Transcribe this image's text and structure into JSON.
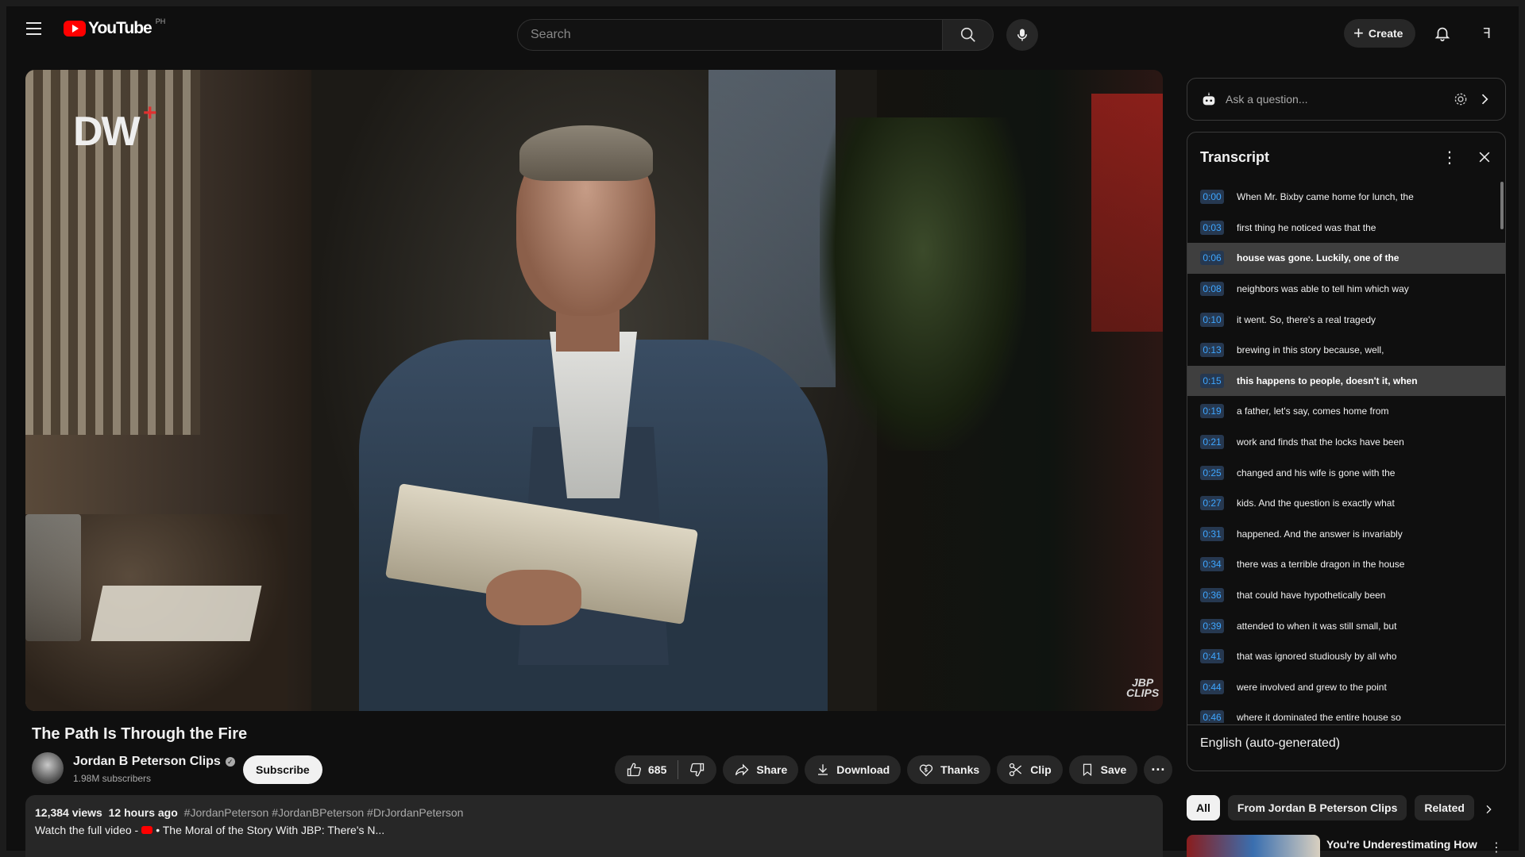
{
  "header": {
    "logo_text": "YouTube",
    "country_code": "PH",
    "search_placeholder": "Search",
    "create_label": "Create",
    "avatar_initial": "ꟻ"
  },
  "player": {
    "watermark_left": "DW",
    "watermark_plus": "+",
    "watermark_right_line1": "JBP",
    "watermark_right_line2": "CLIPS"
  },
  "video": {
    "title": "The Path Is Through the Fire",
    "channel_name": "Jordan B Peterson Clips",
    "subscribers": "1.98M subscribers",
    "subscribe_label": "Subscribe",
    "like_count": "685",
    "share_label": "Share",
    "download_label": "Download",
    "thanks_label": "Thanks",
    "clip_label": "Clip",
    "save_label": "Save"
  },
  "description": {
    "views": "12,384 views",
    "age": "12 hours ago",
    "tags": "#JordanPeterson #JordanBPeterson #DrJordanPeterson",
    "line2_prefix": "Watch the full video -",
    "line2_link": "• The Moral of the Story With JBP: There's N..."
  },
  "ask": {
    "placeholder": "Ask a question..."
  },
  "transcript": {
    "title": "Transcript",
    "language": "English (auto-generated)",
    "rows": [
      {
        "time": "0:00",
        "text": "When Mr. Bixby came home for lunch, the",
        "active": false
      },
      {
        "time": "0:03",
        "text": "first thing he noticed was that the",
        "active": false
      },
      {
        "time": "0:06",
        "text": "house was gone. Luckily, one of the",
        "active": true
      },
      {
        "time": "0:08",
        "text": "neighbors was able to tell him which way",
        "active": false
      },
      {
        "time": "0:10",
        "text": "it went. So, there's a real tragedy",
        "active": false
      },
      {
        "time": "0:13",
        "text": "brewing in this story because, well,",
        "active": false
      },
      {
        "time": "0:15",
        "text": "this happens to people, doesn't it, when",
        "active": true
      },
      {
        "time": "0:19",
        "text": "a father, let's say, comes home from",
        "active": false
      },
      {
        "time": "0:21",
        "text": "work and finds that the locks have been",
        "active": false
      },
      {
        "time": "0:25",
        "text": "changed and his wife is gone with the",
        "active": false
      },
      {
        "time": "0:27",
        "text": "kids. And the question is exactly what",
        "active": false
      },
      {
        "time": "0:31",
        "text": "happened. And the answer is invariably",
        "active": false
      },
      {
        "time": "0:34",
        "text": "there was a terrible dragon in the house",
        "active": false
      },
      {
        "time": "0:36",
        "text": "that could have hypothetically been",
        "active": false
      },
      {
        "time": "0:39",
        "text": "attended to when it was still small, but",
        "active": false
      },
      {
        "time": "0:41",
        "text": "that was ignored studiously by all who",
        "active": false
      },
      {
        "time": "0:44",
        "text": "were involved and grew to the point",
        "active": false
      },
      {
        "time": "0:46",
        "text": "where it dominated the entire house so",
        "active": false
      }
    ]
  },
  "chips": [
    "All",
    "From Jordan B Peterson Clips",
    "Related"
  ],
  "recommendation": {
    "title": "You're Underestimating How"
  },
  "colors": {
    "background": "#0f0f0f",
    "accent_red": "#ff0000",
    "timestamp_blue": "#3ea6ff"
  }
}
